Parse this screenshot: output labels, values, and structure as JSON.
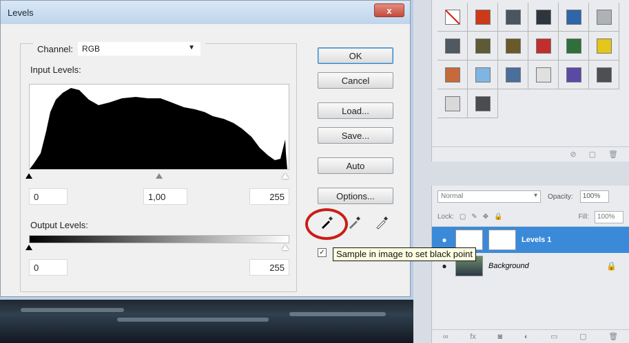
{
  "dialog": {
    "title": "Levels",
    "close_label": "x",
    "channel_label": "Channel:",
    "channel_value": "RGB",
    "input_levels_label": "Input Levels:",
    "input_black": "0",
    "input_gamma": "1,00",
    "input_white": "255",
    "output_levels_label": "Output Levels:",
    "output_black": "0",
    "output_white": "255",
    "buttons": {
      "ok": "OK",
      "cancel": "Cancel",
      "load": "Load...",
      "save": "Save...",
      "auto": "Auto",
      "options": "Options..."
    },
    "preview_checked": true,
    "tooltip": "Sample in image to set black point"
  },
  "layers": {
    "blend_mode": "Normal",
    "opacity_label": "Opacity:",
    "opacity_value": "100%",
    "lock_label": "Lock:",
    "fill_label": "Fill:",
    "fill_value": "100%",
    "items": [
      {
        "name": "Levels 1",
        "selected": true
      },
      {
        "name": "Background",
        "selected": false
      }
    ]
  },
  "swatches": {
    "colors": [
      "#f7f7f7",
      "#cc3a1a",
      "#4b5560",
      "#2f353c",
      "#2f66aa",
      "#aeb2b7",
      "#4e5962",
      "#5e5a36",
      "#6a5a2a",
      "#c22e2e",
      "#2f6f3a",
      "#e3c51b",
      "#c56a3b",
      "#7fb5e3",
      "#4b6f9b",
      "#e0e0e0",
      "#5a4aa6",
      "#4d4f52",
      "#d9d9d9",
      "#4a4c50"
    ]
  },
  "colors": {
    "accent": "#3b8ad9",
    "highlight_ring": "#c81f16",
    "tooltip_bg": "#ffffe1"
  }
}
